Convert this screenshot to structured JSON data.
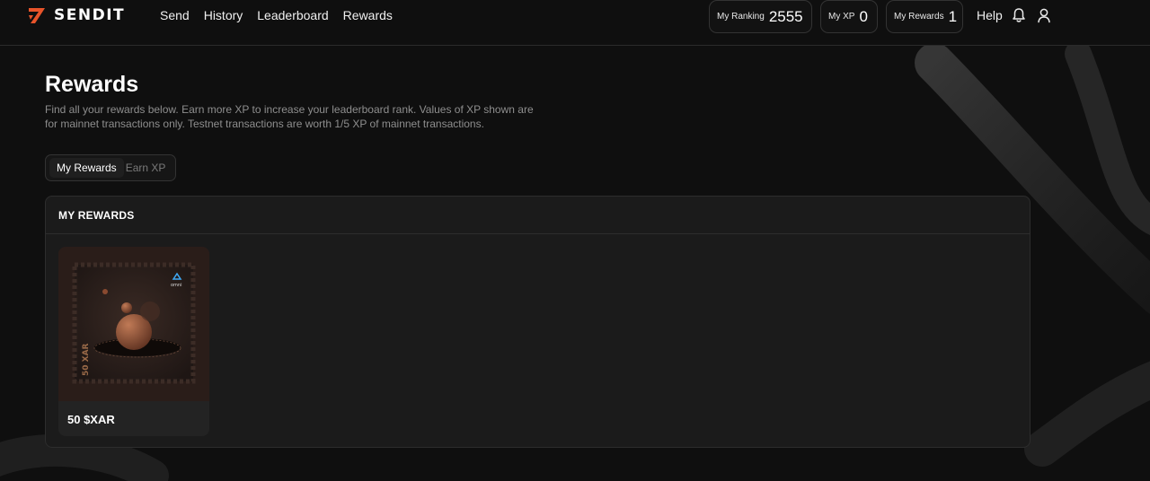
{
  "header": {
    "brand": "SENDIT",
    "nav": [
      {
        "label": "Send"
      },
      {
        "label": "History"
      },
      {
        "label": "Leaderboard"
      },
      {
        "label": "Rewards"
      }
    ],
    "stats": {
      "ranking": {
        "label": "My Ranking",
        "value": "2555"
      },
      "xp": {
        "label": "My XP",
        "value": "0"
      },
      "rewards": {
        "label": "My Rewards",
        "value": "1"
      }
    },
    "help_label": "Help"
  },
  "page": {
    "title": "Rewards",
    "description": "Find all your rewards below. Earn more XP to increase your leaderboard rank. Values of XP shown are for mainnet transactions only. Testnet transactions are worth 1/5 XP of mainnet transactions.",
    "tabs": [
      {
        "label": "My Rewards",
        "active": true
      },
      {
        "label": "Earn XP",
        "active": false
      }
    ]
  },
  "rewards_panel": {
    "title": "MY REWARDS",
    "items": [
      {
        "name": "50 $XAR",
        "stamp_text": "50 XAR",
        "stamp_brand": "omni"
      }
    ]
  },
  "colors": {
    "background": "#0f0f0f",
    "panel": "#1b1b1b",
    "accent_orange": "#e8542a",
    "stamp_brown": "#4a2e22"
  }
}
